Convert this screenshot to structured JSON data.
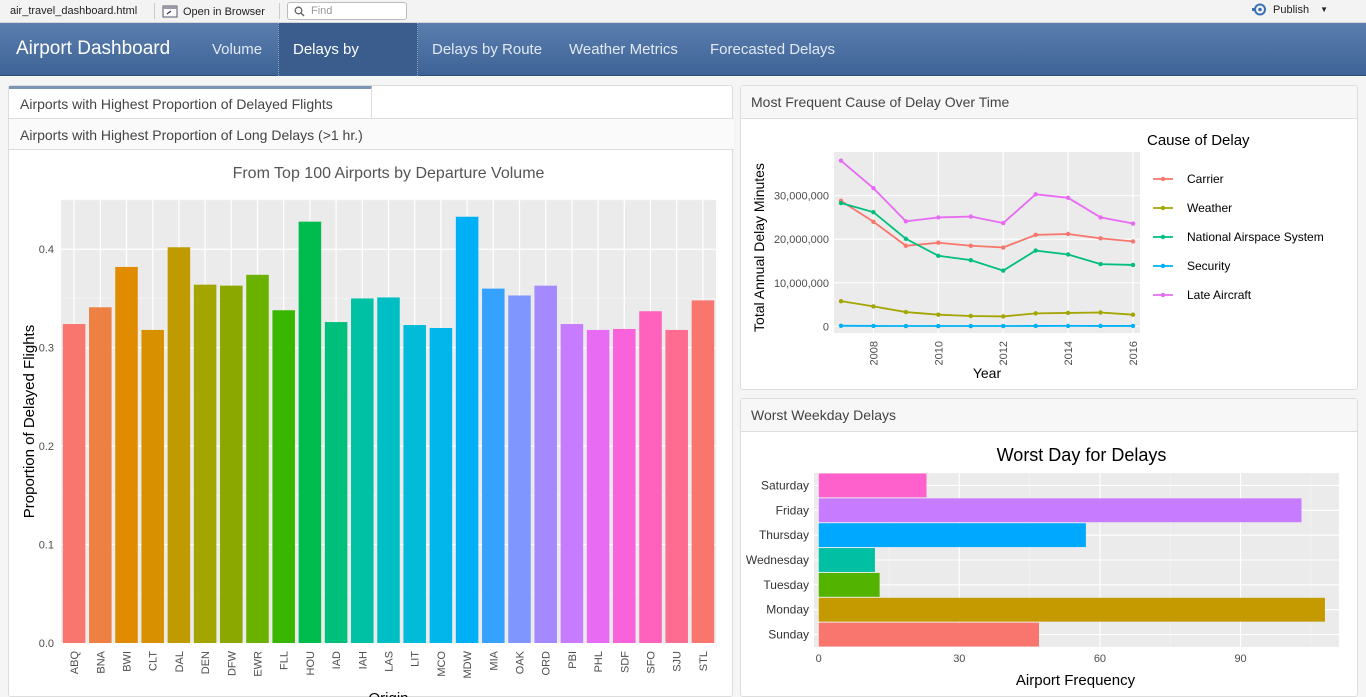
{
  "toolbar": {
    "filename": "air_travel_dashboard.html",
    "open_browser": "Open in Browser",
    "find_placeholder": "Find",
    "publish": "Publish"
  },
  "nav": {
    "brand": "Airport Dashboard",
    "tabs": [
      "Volume",
      "Delays by Origin",
      "Delays by Route",
      "Weather Metrics",
      "Forecasted Delays"
    ],
    "active_index": 1
  },
  "left_panel": {
    "tab_active": "Airports with Highest Proportion of Delayed Flights",
    "tab_other": "Airports with Highest Proportion of Long Delays (>1 hr.)"
  },
  "right_top_panel": {
    "title": "Most Frequent Cause of Delay Over Time"
  },
  "right_bottom_panel": {
    "title": "Worst Weekday Delays"
  },
  "chart_data": [
    {
      "type": "bar",
      "title": "From Top 100 Airports by Departure Volume",
      "xlabel": "Origin",
      "ylabel": "Proportion of Delayed Flights",
      "ylim": [
        0,
        0.45
      ],
      "yticks": [
        "0.0",
        "0.1",
        "0.2",
        "0.3",
        "0.4"
      ],
      "categories": [
        "ABQ",
        "BNA",
        "BWI",
        "CLT",
        "DAL",
        "DEN",
        "DFW",
        "EWR",
        "FLL",
        "HOU",
        "IAD",
        "IAH",
        "LAS",
        "LIT",
        "MCO",
        "MDW",
        "MIA",
        "OAK",
        "ORD",
        "PBI",
        "PHL",
        "SDF",
        "SFO",
        "SJU",
        "STL"
      ],
      "values": [
        0.324,
        0.341,
        0.382,
        0.318,
        0.402,
        0.364,
        0.363,
        0.374,
        0.338,
        0.428,
        0.326,
        0.35,
        0.351,
        0.323,
        0.32,
        0.433,
        0.36,
        0.353,
        0.363,
        0.324,
        0.318,
        0.319,
        0.337,
        0.318,
        0.348
      ],
      "colors": [
        "#f8766d",
        "#ee8044",
        "#e08b00",
        "#d89000",
        "#bf9b00",
        "#a3a500",
        "#8ba800",
        "#6bb100",
        "#39b600",
        "#00bb4e",
        "#00bf7d",
        "#00c1a3",
        "#00bfc4",
        "#00bcd8",
        "#00b6eb",
        "#00b0f6",
        "#35a2ff",
        "#7f96ff",
        "#a58aff",
        "#c77cff",
        "#e76bf3",
        "#fa62db",
        "#ff62bc",
        "#ff6c91",
        "#f8766d"
      ]
    },
    {
      "type": "line",
      "xlabel": "Year",
      "ylabel": "Total Annual Delay Minutes",
      "legend_title": "Cause of Delay",
      "legend_position": "right",
      "x": [
        2007,
        2008,
        2009,
        2010,
        2011,
        2012,
        2013,
        2014,
        2015,
        2016
      ],
      "xticks": [
        "2008",
        "2010",
        "2012",
        "2014",
        "2016"
      ],
      "yticks": [
        "0",
        "10,000,000",
        "20,000,000",
        "30,000,000"
      ],
      "ylim": [
        -1500000,
        40000000
      ],
      "series": [
        {
          "name": "Carrier",
          "color": "#f8766d",
          "values": [
            28800000,
            24000000,
            18500000,
            19200000,
            18500000,
            18100000,
            21000000,
            21200000,
            20200000,
            19500000
          ]
        },
        {
          "name": "Weather",
          "color": "#a3a500",
          "values": [
            5800000,
            4600000,
            3300000,
            2700000,
            2400000,
            2300000,
            3000000,
            3100000,
            3200000,
            2700000
          ]
        },
        {
          "name": "National Airspace System",
          "color": "#00bf7d",
          "values": [
            28300000,
            26200000,
            20100000,
            16200000,
            15200000,
            12800000,
            17400000,
            16500000,
            14300000,
            14100000
          ]
        },
        {
          "name": "Security",
          "color": "#00b0f6",
          "values": [
            150000,
            120000,
            100000,
            100000,
            100000,
            100000,
            120000,
            130000,
            120000,
            120000
          ]
        },
        {
          "name": "Late Aircraft",
          "color": "#e76bf3",
          "values": [
            38000000,
            31700000,
            24100000,
            25000000,
            25200000,
            23700000,
            30300000,
            29500000,
            25000000,
            23600000
          ]
        }
      ]
    },
    {
      "type": "bar",
      "orientation": "horizontal",
      "title": "Worst Day for Delays",
      "xlabel": "Airport Frequency",
      "ylabel": "",
      "xlim": [
        -1,
        111
      ],
      "xticks": [
        "0",
        "30",
        "60",
        "90"
      ],
      "categories": [
        "Saturday",
        "Friday",
        "Thursday",
        "Wednesday",
        "Tuesday",
        "Monday",
        "Sunday"
      ],
      "values": [
        23,
        103,
        57,
        12,
        13,
        108,
        47
      ],
      "colors": [
        "#ff61cc",
        "#c77cff",
        "#00a9ff",
        "#00bfa3",
        "#53b400",
        "#c49a00",
        "#f8766d"
      ]
    }
  ]
}
